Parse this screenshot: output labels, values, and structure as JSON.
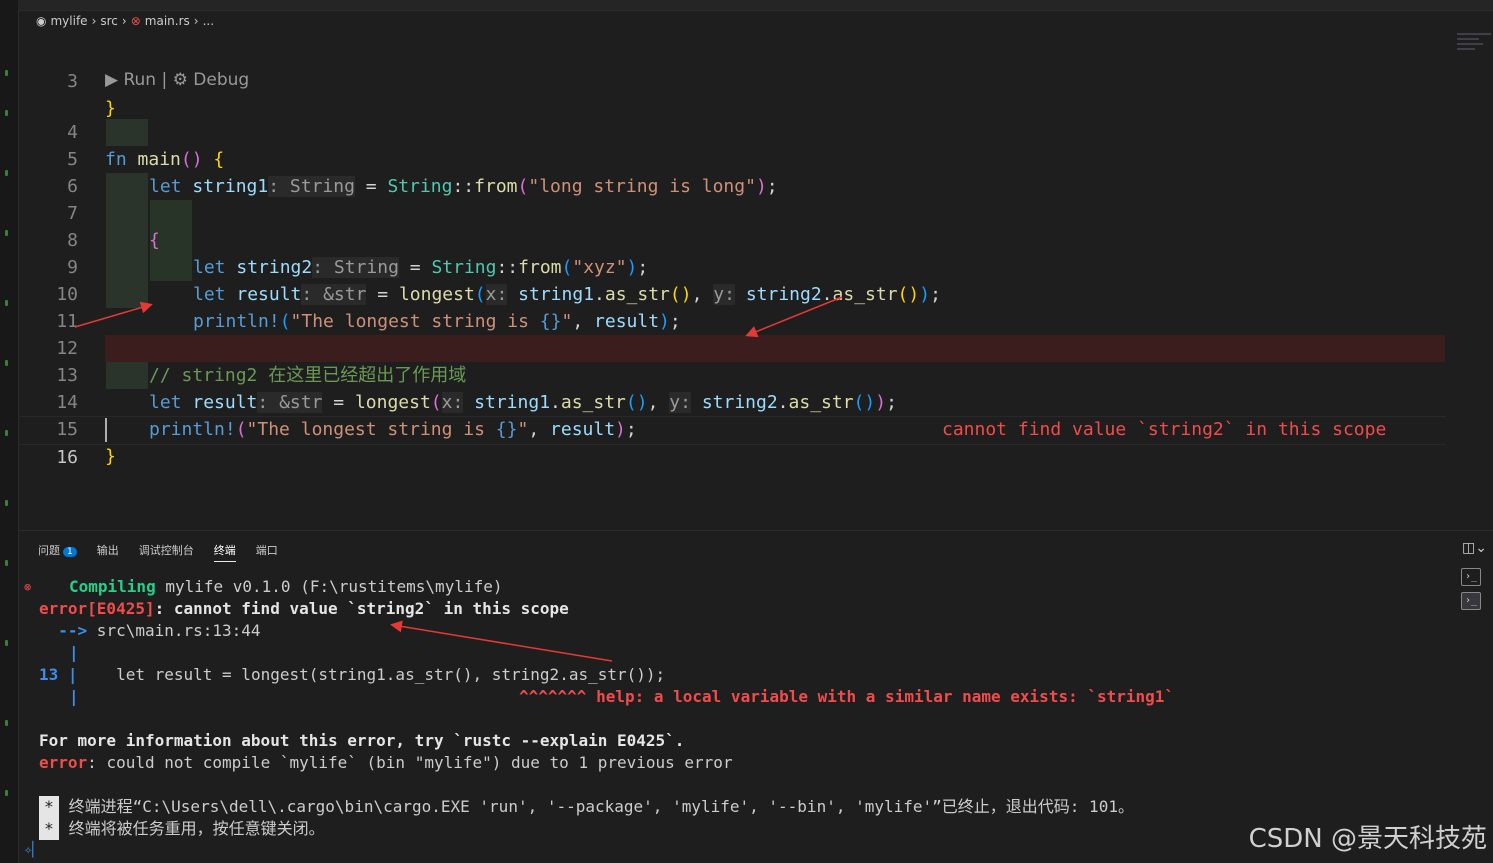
{
  "breadcrumb": {
    "project": "mylife",
    "folder": "src",
    "file": "main.rs",
    "more": "..."
  },
  "codelens": {
    "run": "Run",
    "sep": " | ",
    "debug": "Debug"
  },
  "lines": [
    {
      "n": "3",
      "text": "}"
    },
    {
      "n": "4",
      "text": "fn main() {"
    },
    {
      "n": "5",
      "text": "let string1: String = String::from(\"long string is long\");"
    },
    {
      "n": "6",
      "text": ""
    },
    {
      "n": "7",
      "text": "{"
    },
    {
      "n": "8",
      "text": "let string2: String = String::from(\"xyz\");"
    },
    {
      "n": "9",
      "text": "let result: &str = longest(x: string1.as_str(), y: string2.as_str());"
    },
    {
      "n": "10",
      "text": "println!(\"The longest string is {}\", result);"
    },
    {
      "n": "11",
      "text": "}"
    },
    {
      "n": "12",
      "text": "// string2 在这里已经超出了作用域"
    },
    {
      "n": "13",
      "text": "let result: &str = longest(x: string1.as_str(), y: string2.as_str());"
    },
    {
      "n": "14",
      "text": "println!(\"The longest string is {}\", result);"
    },
    {
      "n": "15",
      "text": "}"
    },
    {
      "n": "16",
      "text": ""
    }
  ],
  "inline_error": "cannot find value `string2` in this scope",
  "panel": {
    "tabs": [
      {
        "label": "问题",
        "badge": "1"
      },
      {
        "label": "输出"
      },
      {
        "label": "调试控制台"
      },
      {
        "label": "终端"
      },
      {
        "label": "端口"
      }
    ],
    "active_tab": "终端"
  },
  "terminal": {
    "compiling": "Compiling",
    "compiling_rest": " mylife v0.1.0 (F:\\rustitems\\mylife)",
    "error_code": "error[E0425]",
    "error_msg": ": cannot find value `string2` in this scope",
    "arrow": "  -->",
    "location": " src\\main.rs:13:44",
    "pipe": "|",
    "src_line_no": "13",
    "src_line": "    let result = longest(string1.as_str(), string2.as_str());",
    "carets": "^^^^^^^",
    "help": " help: a local variable with a similar name exists: `string1`",
    "more_info": "For more information about this error, try `rustc --explain E0425`.",
    "err2_label": "error",
    "err2_msg": ": could not compile `mylife` (bin \"mylife\") due to 1 previous error",
    "star": "*",
    "exit_line": " 终端进程“C:\\Users\\dell\\.cargo\\bin\\cargo.EXE 'run', '--package', 'mylife', '--bin', 'mylife'”已终止，退出代码: 101。",
    "reuse_line": " 终端将被任务重用，按任意键关闭。"
  },
  "watermark": "CSDN @景天科技苑",
  "colors": {
    "error": "#f14c4c",
    "keyword": "#569cd6",
    "type": "#4ec9b0",
    "string": "#ce9178",
    "function": "#dcdcaa"
  }
}
